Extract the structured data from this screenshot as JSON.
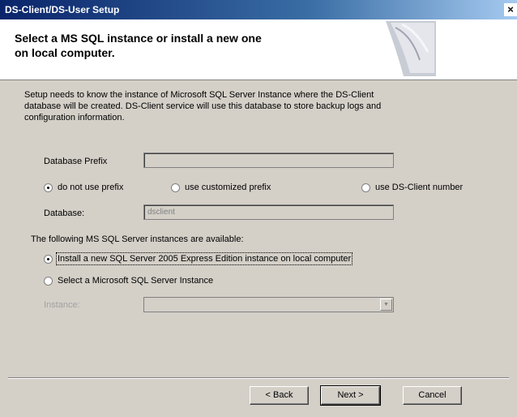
{
  "window": {
    "title": "DS-Client/DS-User Setup",
    "close_glyph": "×"
  },
  "header": {
    "title_line1": "Select a MS SQL instance or install a new one",
    "title_line2": "on local computer."
  },
  "intro": {
    "line1": "Setup needs to know the instance of Microsoft SQL Server Instance where the DS-Client",
    "line2": "database will be created. DS-Client service will use this database to store backup logs and",
    "line3": "configuration information."
  },
  "prefix": {
    "label": "Database Prefix",
    "value": "",
    "options": [
      {
        "label": "do not use prefix",
        "selected": true
      },
      {
        "label": "use customized prefix",
        "selected": false
      },
      {
        "label": "use DS-Client number",
        "selected": false
      }
    ]
  },
  "database": {
    "label": "Database:",
    "value": "dsclient"
  },
  "instances": {
    "heading": "The following MS SQL Server instances are available:",
    "options": [
      {
        "label": "Install a new SQL Server 2005 Express Edition instance on local computer",
        "selected": true
      },
      {
        "label": "Select a Microsoft SQL Server Instance",
        "selected": false
      }
    ],
    "instance_label": "Instance:",
    "instance_value": ""
  },
  "buttons": {
    "back": "< Back",
    "next": "Next >",
    "cancel": "Cancel"
  }
}
